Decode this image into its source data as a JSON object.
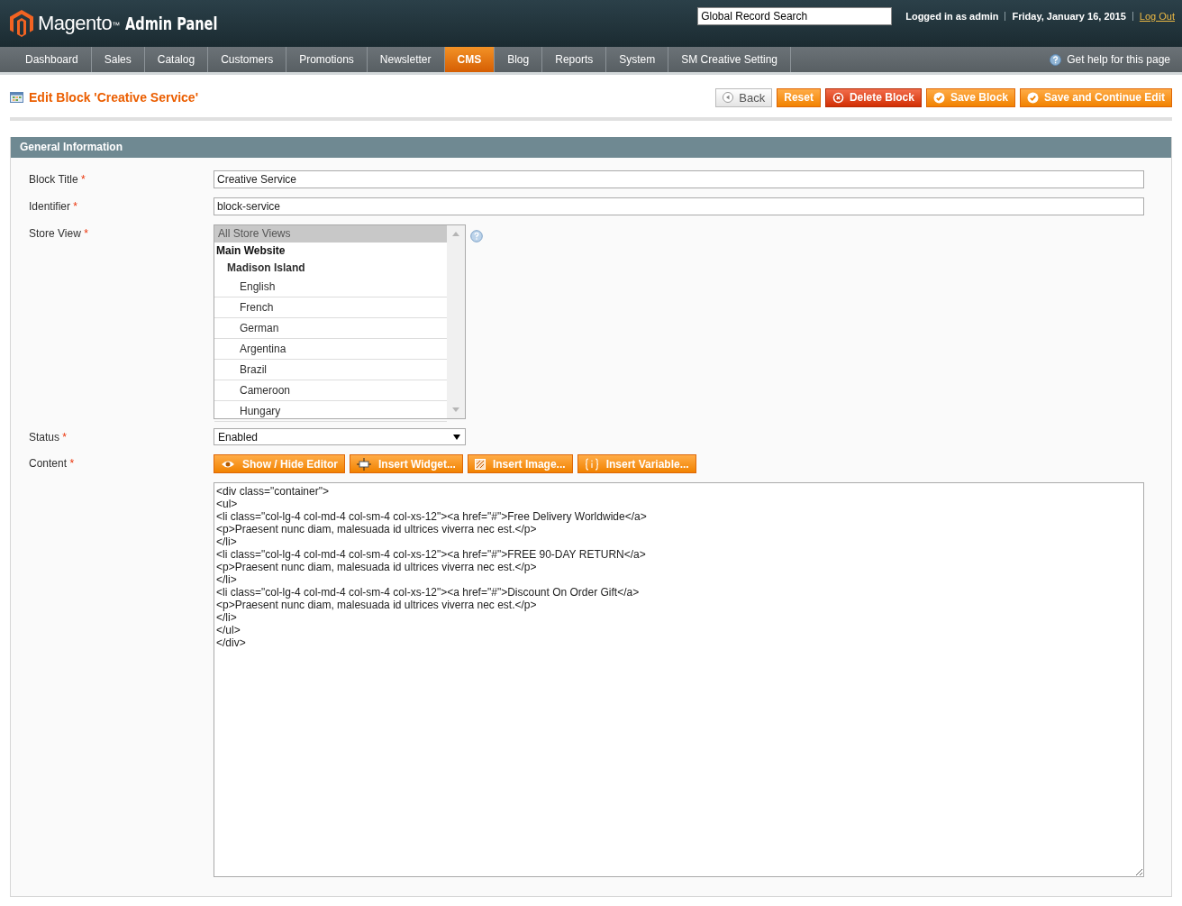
{
  "header": {
    "logo": {
      "brand": "Magento",
      "mark": "™",
      "product": "Admin Panel"
    },
    "search": {
      "value": "Global Record Search"
    },
    "user": "Logged in as admin",
    "date": "Friday, January 16, 2015",
    "logout": "Log Out"
  },
  "nav": {
    "items": [
      {
        "label": "Dashboard",
        "selected": false
      },
      {
        "label": "Sales",
        "selected": false
      },
      {
        "label": "Catalog",
        "selected": false
      },
      {
        "label": "Customers",
        "selected": false
      },
      {
        "label": "Promotions",
        "selected": false
      },
      {
        "label": "Newsletter",
        "selected": false
      },
      {
        "label": "CMS",
        "selected": true
      },
      {
        "label": "Blog",
        "selected": false
      },
      {
        "label": "Reports",
        "selected": false
      },
      {
        "label": "System",
        "selected": false
      },
      {
        "label": "SM Creative Setting",
        "selected": false
      }
    ],
    "help": "Get help for this page"
  },
  "page": {
    "title": "Edit Block 'Creative Service'",
    "buttons": [
      {
        "kind": "back",
        "label": "Back"
      },
      {
        "kind": "reset",
        "label": "Reset"
      },
      {
        "kind": "delete",
        "label": "Delete Block"
      },
      {
        "kind": "save",
        "label": "Save Block"
      },
      {
        "kind": "save",
        "label": "Save and Continue Edit"
      }
    ]
  },
  "form": {
    "section": "General Information",
    "required_mark": "*",
    "block_title": {
      "label": "Block Title",
      "value": "Creative Service"
    },
    "identifier": {
      "label": "Identifier",
      "value": "block-service"
    },
    "store_view": {
      "label": "Store View",
      "options": [
        {
          "label": "All Store Views",
          "selected": true
        },
        {
          "label": "Main Website",
          "selected": false,
          "children": [
            {
              "label": "Madison Island",
              "selected": false,
              "children": [
                {
                  "label": "English",
                  "selected": false
                },
                {
                  "label": "French",
                  "selected": false
                },
                {
                  "label": "German",
                  "selected": false
                },
                {
                  "label": "Argentina",
                  "selected": false
                },
                {
                  "label": "Brazil",
                  "selected": false
                },
                {
                  "label": "Cameroon",
                  "selected": false
                },
                {
                  "label": "Hungary",
                  "selected": false
                }
              ]
            }
          ]
        }
      ]
    },
    "status": {
      "label": "Status",
      "value": "Enabled"
    },
    "content": {
      "label": "Content",
      "buttons": [
        {
          "kind": "eye",
          "label": "Show / Hide Editor"
        },
        {
          "kind": "widget",
          "label": "Insert Widget..."
        },
        {
          "kind": "image",
          "label": "Insert Image..."
        },
        {
          "kind": "variable",
          "label": "Insert Variable..."
        }
      ],
      "value": "<div class=\"container\">\n<ul>\n<li class=\"col-lg-4 col-md-4 col-sm-4 col-xs-12\"><a href=\"#\">Free Delivery Worldwide</a>\n<p>Praesent nunc diam, malesuada id ultrices viverra nec est.</p>\n</li>\n<li class=\"col-lg-4 col-md-4 col-sm-4 col-xs-12\"><a href=\"#\">FREE 90-DAY RETURN</a>\n<p>Praesent nunc diam, malesuada id ultrices viverra nec est.</p>\n</li>\n<li class=\"col-lg-4 col-md-4 col-sm-4 col-xs-12\"><a href=\"#\">Discount On Order Gift</a>\n<p>Praesent nunc diam, malesuada id ultrices viverra nec est.</p>\n</li>\n</ul>\n</div>"
    }
  }
}
